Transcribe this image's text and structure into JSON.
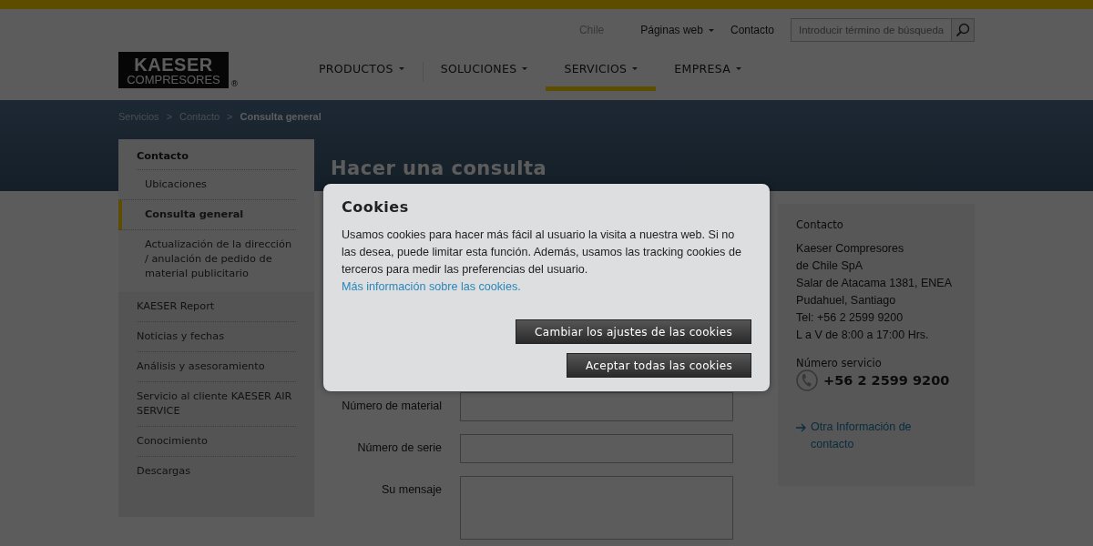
{
  "top_links": {
    "country": "Chile",
    "links": [
      {
        "label": "Páginas web",
        "dropdown": true
      },
      {
        "label": "Contacto",
        "dropdown": false
      }
    ]
  },
  "search": {
    "placeholder": "Introducir término de búsqueda"
  },
  "logo": {
    "line1": "KAESER",
    "line2": "COMPRESORES",
    "mark": "®"
  },
  "main_nav": [
    {
      "label": "PRODUCTOS",
      "selected": false
    },
    {
      "label": "SOLUCIONES",
      "selected": false
    },
    {
      "label": "SERVICIOS",
      "selected": true
    },
    {
      "label": "EMPRESA",
      "selected": false
    }
  ],
  "breadcrumb": [
    {
      "label": "Servicios",
      "current": false
    },
    {
      "label": "Contacto",
      "current": false
    },
    {
      "label": "Consulta general",
      "current": true
    }
  ],
  "breadcrumb_separator": ">",
  "sidebar": {
    "items": [
      {
        "label": "Contacto",
        "expanded": true,
        "children": [
          {
            "label": "Ubicaciones",
            "selected": false
          },
          {
            "label": "Consulta general",
            "selected": true
          },
          {
            "label": "Actualización de la dirección / anulación de pedido de material publicitario",
            "selected": false
          }
        ]
      },
      {
        "label": "KAESER Report",
        "expanded": false
      },
      {
        "label": "Noticias y fechas",
        "expanded": false
      },
      {
        "label": "Análisis y asesoramiento",
        "expanded": false
      },
      {
        "label": "Servicio al cliente KAESER AIR SERVICE",
        "expanded": false
      },
      {
        "label": "Conocimiento",
        "expanded": false
      },
      {
        "label": "Descargas",
        "expanded": false
      }
    ]
  },
  "page_title": "Hacer una consulta",
  "form_fields": [
    {
      "label": "Número de material",
      "kind": "input"
    },
    {
      "label": "Número de serie",
      "kind": "input"
    },
    {
      "label": "Su mensaje",
      "kind": "textarea"
    }
  ],
  "contact_box": {
    "title": "Contacto",
    "lines": [
      "Kaeser Compresores",
      "de Chile SpA",
      "Salar de Atacama 1381, ENEA",
      "Pudahuel, Santiago",
      "Tel: +56 2 2599 9200",
      "L a V de 8:00 a 17:00 Hrs."
    ],
    "service_label": "Número servicio",
    "service_phone": "+56 2 2599 9200",
    "link": "Otra Información de contacto"
  },
  "cookie_dialog": {
    "title": "Cookies",
    "text": "Usamos cookies para hacer más fácil al usuario la visita a nuestra web. Si no las desea, puede limitar esta función. Además, usamos las tracking cookies de terceros para medir las preferencias del usuario.",
    "link": "Más información sobre las cookies.",
    "buttons": [
      "Cambiar los ajustes de las cookies",
      "Aceptar todas las cookies"
    ]
  }
}
